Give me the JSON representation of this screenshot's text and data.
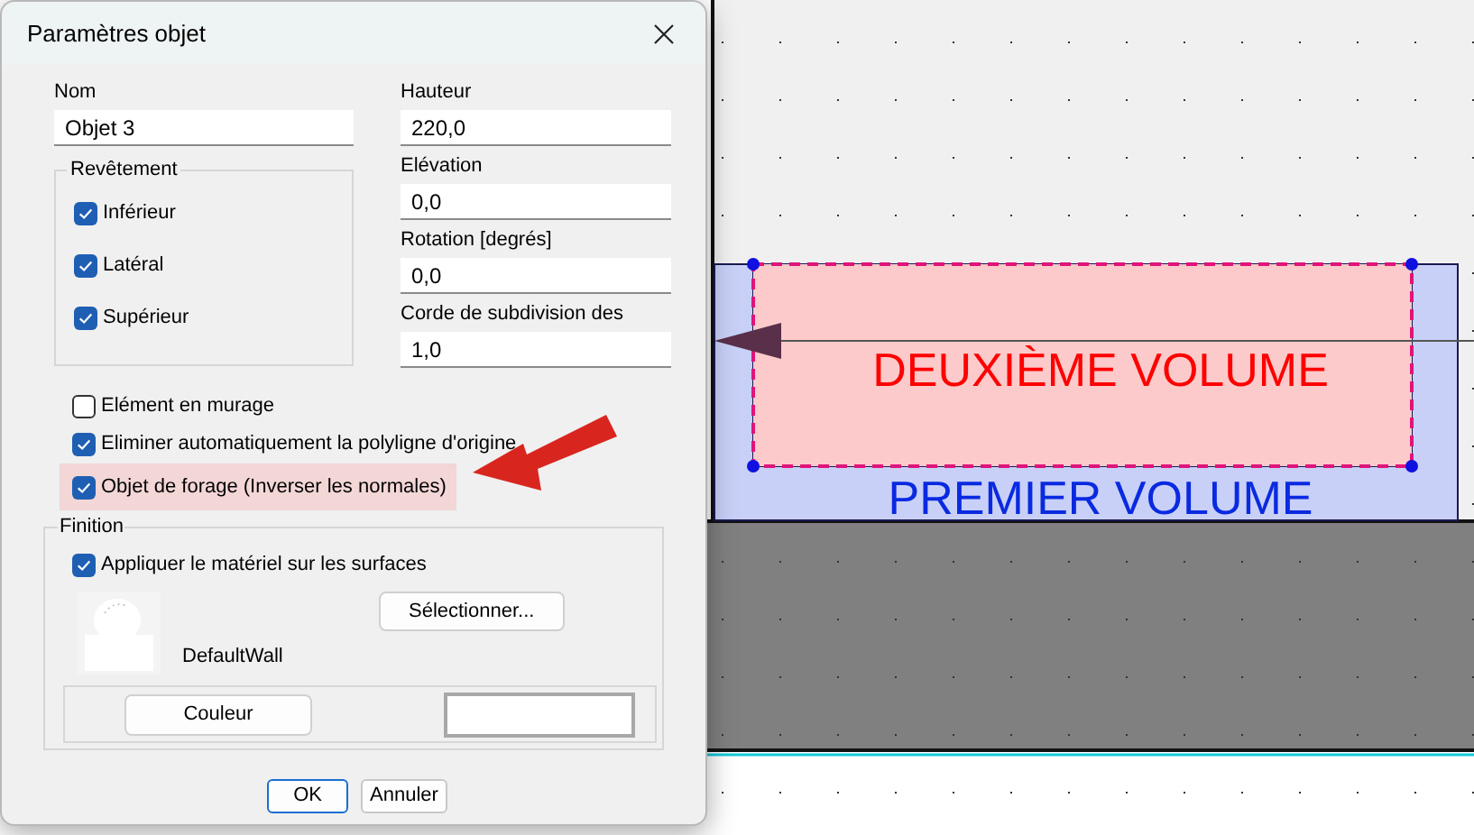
{
  "dialog": {
    "title": "Paramètres objet",
    "name_field": {
      "label": "Nom",
      "value": "Objet 3"
    },
    "coating_group": {
      "title": "Revêtement",
      "options": [
        {
          "label": "Inférieur",
          "checked": true
        },
        {
          "label": "Latéral",
          "checked": true
        },
        {
          "label": "Supérieur",
          "checked": true
        }
      ]
    },
    "right_fields": [
      {
        "label": "Hauteur",
        "value": "220,0"
      },
      {
        "label": "Elévation",
        "value": "0,0"
      },
      {
        "label": "Rotation  [degrés]",
        "value": "0,0"
      },
      {
        "label": "Corde de subdivision des",
        "value": "1,0"
      }
    ],
    "options": [
      {
        "label": "Elément en murage",
        "checked": false,
        "highlighted": false
      },
      {
        "label": "Eliminer automatiquement la polyligne d'origine",
        "checked": true,
        "highlighted": false
      },
      {
        "label": "Objet de forage (Inverser les normales)",
        "checked": true,
        "highlighted": true
      }
    ],
    "finish_group": {
      "title": "Finition",
      "apply_material": {
        "label": "Appliquer le matériel sur les surfaces",
        "checked": true
      },
      "select_button": "Sélectionner...",
      "material_name": "DefaultWall",
      "color_button": "Couleur"
    },
    "buttons": [
      {
        "label": "OK",
        "default": true
      },
      {
        "label": "Annuler",
        "default": false
      }
    ]
  },
  "canvas": {
    "inner_label": "DEUXIÈME VOLUME",
    "outer_label": "PREMIER VOLUME"
  }
}
